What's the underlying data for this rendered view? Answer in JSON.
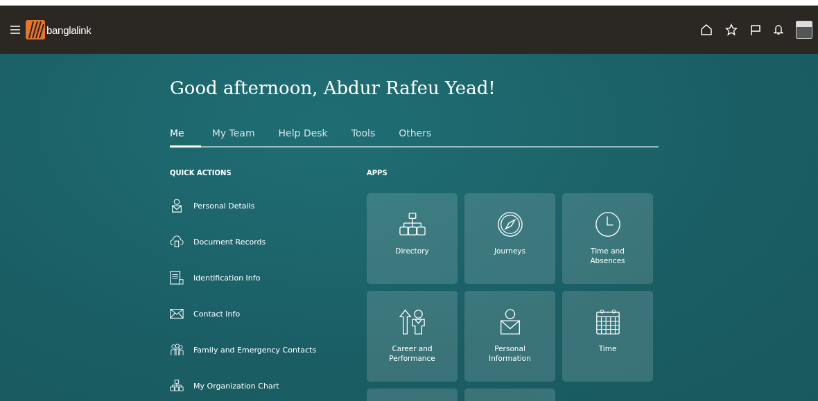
{
  "header": {
    "brand": "banglalink"
  },
  "greeting": "Good afternoon, Abdur Rafeu Yead!",
  "tabs": [
    {
      "label": "Me",
      "selected": true
    },
    {
      "label": "My Team",
      "selected": false
    },
    {
      "label": "Help Desk",
      "selected": false
    },
    {
      "label": "Tools",
      "selected": false
    },
    {
      "label": "Others",
      "selected": false
    }
  ],
  "quick_actions": {
    "heading": "QUICK ACTIONS",
    "items": [
      "Personal Details",
      "Document Records",
      "Identification Info",
      "Contact Info",
      "Family and Emergency Contacts",
      "My Organization Chart"
    ]
  },
  "apps": {
    "heading": "APPS",
    "items": [
      "Directory",
      "Journeys",
      "Time and Absences",
      "Career and Performance",
      "Personal Information",
      "Time"
    ]
  }
}
